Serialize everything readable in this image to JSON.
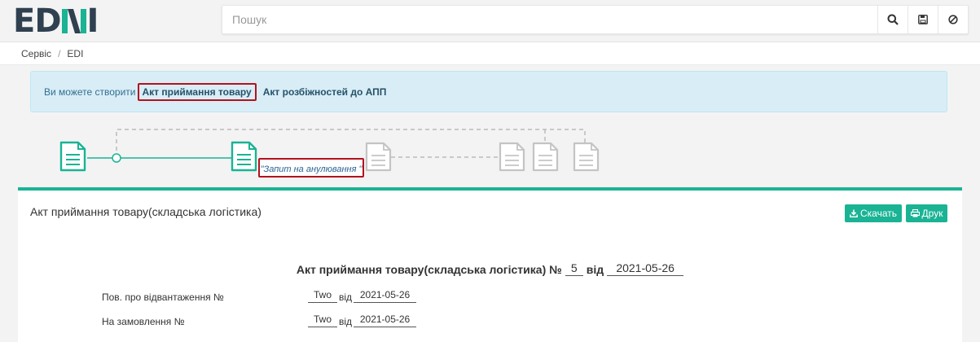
{
  "brand": {
    "part1": "ED",
    "part2": "N",
    "part3": "I"
  },
  "search": {
    "placeholder": "Пошук"
  },
  "breadcrumb": {
    "items": [
      "Сервіс",
      "EDI"
    ]
  },
  "alert": {
    "prefix": "Ви можете створити",
    "link1": "Акт приймання товару",
    "link2": "Акт розбіжностей до АПП"
  },
  "timeline": {
    "status_label": "\"Запит на анулювання \""
  },
  "panel": {
    "title": "Акт приймання товару(складська логістика)",
    "download_label": "Скачать",
    "print_label": "Друк"
  },
  "document": {
    "heading": "Акт приймання товару(складська логістика) №",
    "number": "5",
    "from_label": "від",
    "date": "2021-05-26",
    "rows": [
      {
        "label": "Пов. про відвантаження №",
        "number": "Two",
        "from_label": "від",
        "date": "2021-05-26"
      },
      {
        "label": "На замовлення №",
        "number": "Two",
        "from_label": "від",
        "date": "2021-05-26"
      }
    ]
  },
  "colors": {
    "accent": "#1ab394",
    "highlight": "#b3121d",
    "alert_bg": "#d9edf7"
  }
}
